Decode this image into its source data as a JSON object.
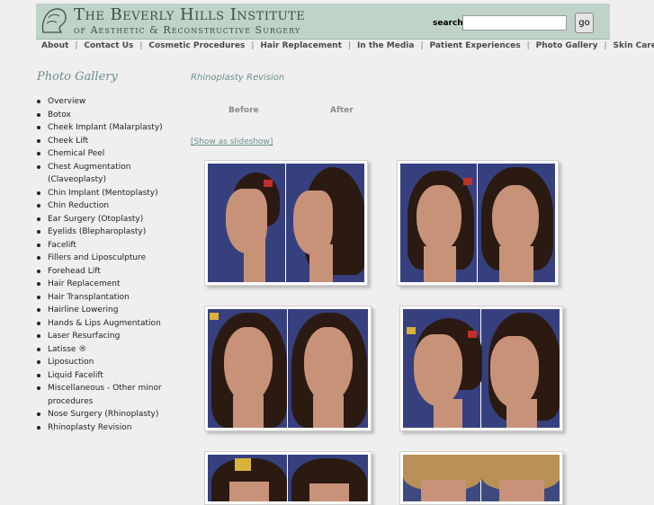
{
  "header": {
    "title_line1": "The Beverly Hills Institute",
    "title_line2": "of Aesthetic & Reconstructive Surgery",
    "search_label": "search",
    "search_value": "",
    "go_label": "go"
  },
  "topnav": [
    {
      "label": "About"
    },
    {
      "label": "Contact Us"
    },
    {
      "label": "Cosmetic Procedures"
    },
    {
      "label": "Hair Replacement"
    },
    {
      "label": "In the Media"
    },
    {
      "label": "Patient Experiences"
    },
    {
      "label": "Photo Gallery"
    },
    {
      "label": "Skin Care"
    }
  ],
  "sidebar": {
    "title": "Photo Gallery",
    "items": [
      "Overview",
      "Botox",
      "Cheek Implant (Malarplasty)",
      "Cheek Lift",
      "Chemical Peel",
      "Chest Augmentation (Claveoplasty)",
      "Chin Implant (Mentoplasty)",
      "Chin Reduction",
      "Ear Surgery (Otoplasty)",
      "Eyelids (Blepharoplasty)",
      "Facelift",
      "Fillers and Liposculpture",
      "Forehead Lift",
      "Hair Replacement",
      "Hair Transplantation",
      "Hairline Lowering",
      "Hands & Lips Augmentation",
      "Laser Resurfacing",
      "Latisse ®",
      "Liposuction",
      "Liquid Facelift",
      "Miscellaneous - Other minor procedures",
      "Nose Surgery (Rhinoplasty)",
      "Rhinoplasty Revision"
    ]
  },
  "main": {
    "page_title": "Rhinoplasty Revision",
    "before_label": "Before",
    "after_label": "After",
    "slideshow_link": "[Show as slideshow]"
  },
  "colors": {
    "header_bg": "#bfd3c8",
    "accent_teal": "#6b9090",
    "page_bg": "#efefef"
  }
}
